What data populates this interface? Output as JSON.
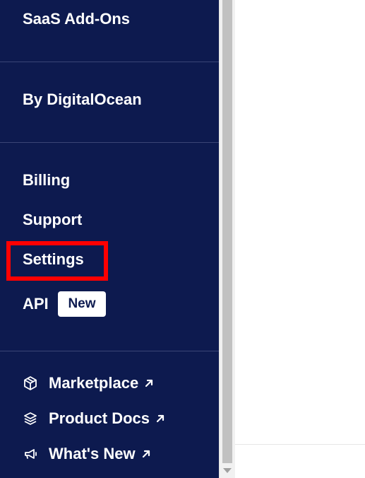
{
  "sidebar": {
    "saas_addons": "SaaS Add-Ons",
    "by_digitalocean": "By DigitalOcean",
    "billing": "Billing",
    "support": "Support",
    "settings": "Settings",
    "api": "API",
    "api_badge": "New",
    "external_links": [
      {
        "label": "Marketplace",
        "icon": "cube-icon"
      },
      {
        "label": "Product Docs",
        "icon": "layers-icon"
      },
      {
        "label": "What's New",
        "icon": "megaphone-icon"
      }
    ]
  },
  "colors": {
    "sidebar_bg": "#0d1a4f",
    "highlight": "#ff0000",
    "text": "#ffffff"
  }
}
